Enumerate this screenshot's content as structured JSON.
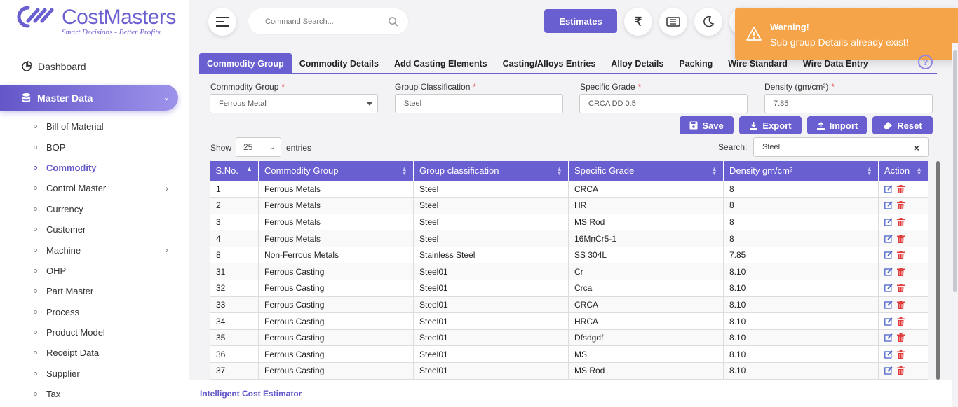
{
  "brand": {
    "title": "CostMasters",
    "tagline": "Smart Decisions - Better Profits",
    "color": "#6a5fd0"
  },
  "sidebar": {
    "dashboard": "Dashboard",
    "master": "Master Data",
    "items": [
      {
        "label": "Bill of Material",
        "expandable": false
      },
      {
        "label": "BOP",
        "expandable": false
      },
      {
        "label": "Commodity",
        "expandable": false,
        "active": true
      },
      {
        "label": "Control Master",
        "expandable": true
      },
      {
        "label": "Currency",
        "expandable": false
      },
      {
        "label": "Customer",
        "expandable": false
      },
      {
        "label": "Machine",
        "expandable": true
      },
      {
        "label": "OHP",
        "expandable": false
      },
      {
        "label": "Part Master",
        "expandable": false
      },
      {
        "label": "Process",
        "expandable": false
      },
      {
        "label": "Product Model",
        "expandable": false
      },
      {
        "label": "Receipt Data",
        "expandable": false
      },
      {
        "label": "Supplier",
        "expandable": false
      },
      {
        "label": "Tax",
        "expandable": false
      }
    ]
  },
  "header": {
    "command_placeholder": "Command Search...",
    "estimates": "Estimates",
    "icons": [
      "rupee-icon",
      "ticket-icon",
      "moon-icon",
      "fullscreen-icon",
      "notification-icon",
      "avatar",
      "logout-icon",
      "search-icon",
      "gear-icon"
    ]
  },
  "toast": {
    "title": "Warning!",
    "message": "Sub group Details already exist!",
    "color": "#f5a449"
  },
  "tabs": [
    "Commodity Group",
    "Commodity Details",
    "Add Casting Elements",
    "Casting/Alloys Entries",
    "Alloy Details",
    "Packing",
    "Wire Standard",
    "Wire Data Entry"
  ],
  "form": {
    "commodity_group": {
      "label": "Commodity Group",
      "value": "Ferrous Metal"
    },
    "group_classification": {
      "label": "Group Classification",
      "value": "Steel"
    },
    "specific_grade": {
      "label": "Specific Grade",
      "value": "CRCA DD 0.5"
    },
    "density": {
      "label": "Density (gm/cm³)",
      "value": "7.85"
    }
  },
  "buttons": {
    "save": "Save",
    "export": "Export",
    "import": "Import",
    "reset": "Reset"
  },
  "table_controls": {
    "show": "Show",
    "entries_value": "25",
    "entries": "entries",
    "search_label": "Search:",
    "search_value": "Steel"
  },
  "table": {
    "headers": [
      "S.No.",
      "Commodity Group",
      "Group classification",
      "Specific Grade",
      "Density gm/cm³",
      "Action"
    ],
    "rows": [
      [
        "1",
        "Ferrous Metals",
        "Steel",
        "CRCA",
        "8"
      ],
      [
        "2",
        "Ferrous Metals",
        "Steel",
        "HR",
        "8"
      ],
      [
        "3",
        "Ferrous Metals",
        "Steel",
        "MS Rod",
        "8"
      ],
      [
        "4",
        "Ferrous Metals",
        "Steel",
        "16MnCr5-1",
        "8"
      ],
      [
        "8",
        "Non-Ferrous Metals",
        "Stainless Steel",
        "SS 304L",
        "7.85"
      ],
      [
        "31",
        "Ferrous Casting",
        "Steel01",
        "Cr",
        "8.10"
      ],
      [
        "32",
        "Ferrous Casting",
        "Steel01",
        "Crca",
        "8.10"
      ],
      [
        "33",
        "Ferrous Casting",
        "Steel01",
        "CRCA",
        "8.10"
      ],
      [
        "34",
        "Ferrous Casting",
        "Steel01",
        "HRCA",
        "8.10"
      ],
      [
        "35",
        "Ferrous Casting",
        "Steel01",
        "Dfsdgdf",
        "8.10"
      ],
      [
        "36",
        "Ferrous Casting",
        "Steel01",
        "MS",
        "8.10"
      ],
      [
        "37",
        "Ferrous Casting",
        "Steel01",
        "MS Rod",
        "8.10"
      ],
      [
        "",
        "",
        "",
        "",
        ""
      ]
    ]
  },
  "footer": "Intelligent Cost Estimator"
}
